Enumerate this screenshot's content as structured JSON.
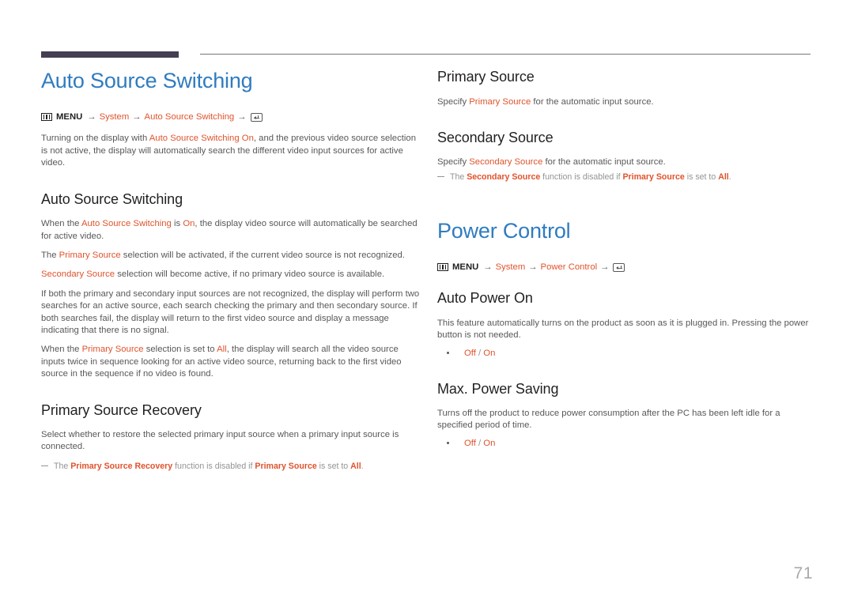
{
  "document": {
    "page_number": "71",
    "accent_blue": "#2f7cc0",
    "accent_orange": "#e0532c",
    "rule_dark": "#453e52",
    "body_gray": "#58585b",
    "note_gray": "#949497"
  },
  "left_column": {
    "title": "Auto Source Switching",
    "menu_path": {
      "menu_label": "MENU",
      "arrow": "→",
      "items": [
        "System",
        "Auto Source Switching"
      ],
      "menu_icon": "menu-box-icon",
      "enter_icon": "enter-key-icon"
    },
    "intro": {
      "part1": "Turning on the display with ",
      "highlight1": "Auto Source Switching On",
      "part2": ", and the previous video source selection is not active, the display will automatically search the different video input sources for active video."
    },
    "section1": {
      "heading": "Auto Source Switching",
      "p1": {
        "part1": "When the ",
        "highlight1": "Auto Source Switching",
        "part2": " is ",
        "highlight2": "On",
        "part3": ", the display video source will automatically be searched for active video."
      },
      "p2": {
        "part1": "The ",
        "highlight1": "Primary Source",
        "part2": " selection will be activated, if the current video source is not recognized."
      },
      "p3": {
        "highlight1": "Secondary Source",
        "part2": " selection will become active, if no primary video source is available."
      },
      "p4": "If both the primary and secondary input sources are not recognized, the display will perform two searches for an active source, each search checking the primary and then secondary source. If both searches fail, the display will return to the first video source and display a message indicating that there is no signal.",
      "p5": {
        "part1": "When the ",
        "highlight1": "Primary Source",
        "part2": " selection is set to ",
        "highlight2": "All",
        "part3": ", the display will search all the video source inputs twice in sequence looking for an active video source, returning back to the first video source in the sequence if no video is found."
      }
    },
    "section2": {
      "heading": "Primary Source Recovery",
      "p1": "Select whether to restore the selected primary input source when a primary input source is connected.",
      "note": {
        "part1": "The ",
        "highlight1": "Primary Source Recovery",
        "part2": " function is disabled if ",
        "highlight2": "Primary Source",
        "part3": " is set to ",
        "highlight3": "All",
        "part4": "."
      }
    }
  },
  "right_column": {
    "section1": {
      "heading": "Primary Source",
      "p1": {
        "part1": "Specify ",
        "highlight1": "Primary Source",
        "part2": " for the automatic input source."
      }
    },
    "section2": {
      "heading": "Secondary Source",
      "p1": {
        "part1": "Specify ",
        "highlight1": "Secondary Source",
        "part2": " for the automatic input source."
      },
      "note": {
        "part1": "The ",
        "highlight1": "Secondary Source",
        "part2": " function is disabled if ",
        "highlight2": "Primary Source",
        "part3": " is set to ",
        "highlight3": "All",
        "part4": "."
      }
    },
    "title": "Power Control",
    "menu_path": {
      "menu_label": "MENU",
      "arrow": "→",
      "items": [
        "System",
        "Power Control"
      ],
      "menu_icon": "menu-box-icon",
      "enter_icon": "enter-key-icon"
    },
    "section3": {
      "heading": "Auto Power On",
      "p1": "This feature automatically turns on the product as soon as it is plugged in. Pressing the power button is not needed.",
      "options": [
        {
          "value1": "Off",
          "separator": " / ",
          "value2": "On"
        }
      ]
    },
    "section4": {
      "heading": "Max. Power Saving",
      "p1": "Turns off the product to reduce power consumption after the PC has been left idle for a specified period of time.",
      "options": [
        {
          "value1": "Off",
          "separator": " / ",
          "value2": "On"
        }
      ]
    }
  }
}
